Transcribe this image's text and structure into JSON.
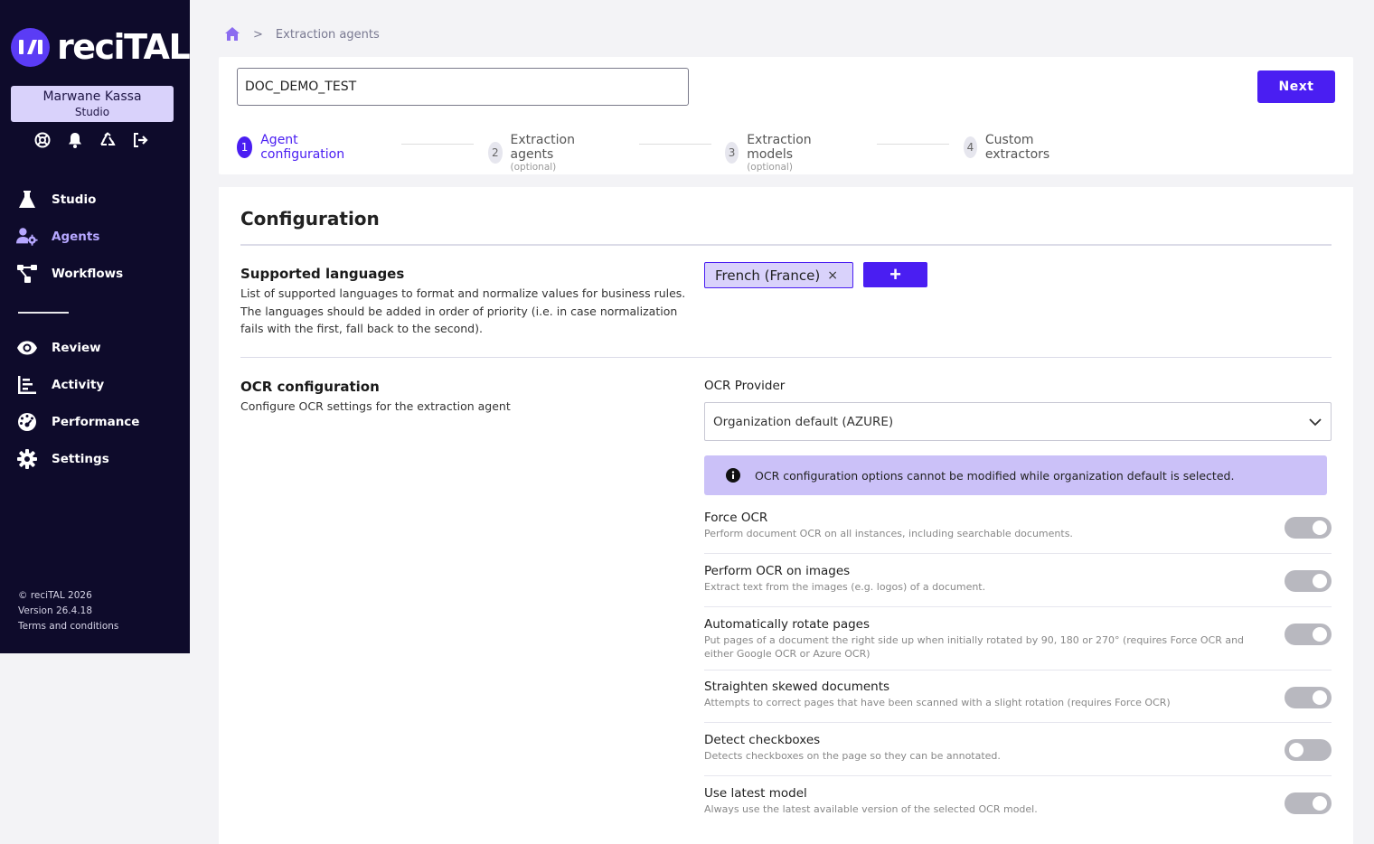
{
  "brand": {
    "logo_mark": "I/I",
    "name": "reciTAL"
  },
  "user": {
    "name": "Marwane Kassa",
    "role": "Studio"
  },
  "quick_icons": [
    "support-icon",
    "bell-icon",
    "recycle-icon",
    "logout-icon"
  ],
  "nav": {
    "primary": [
      {
        "label": "Studio",
        "icon": "flask-icon"
      },
      {
        "label": "Agents",
        "icon": "agents-icon",
        "active": true
      },
      {
        "label": "Workflows",
        "icon": "workflow-icon"
      }
    ],
    "secondary": [
      {
        "label": "Review",
        "icon": "eye-icon"
      },
      {
        "label": "Activity",
        "icon": "chart-icon"
      },
      {
        "label": "Performance",
        "icon": "gauge-icon"
      },
      {
        "label": "Settings",
        "icon": "gear-icon"
      }
    ]
  },
  "footer": {
    "copyright": "© reciTAL 2026",
    "version": "Version 26.4.18",
    "terms": "Terms and conditions"
  },
  "breadcrumb": {
    "separator": ">",
    "current": "Extraction agents"
  },
  "agent_name": {
    "value": "DOC_DEMO_TEST"
  },
  "next_label": "Next",
  "steps": [
    {
      "num": "1",
      "label": "Agent configuration",
      "sub": "",
      "active": true
    },
    {
      "num": "2",
      "label": "Extraction agents",
      "sub": "(optional)"
    },
    {
      "num": "3",
      "label": "Extraction models",
      "sub": "(optional)"
    },
    {
      "num": "4",
      "label": "Custom extractors",
      "sub": ""
    }
  ],
  "config": {
    "title": "Configuration",
    "languages": {
      "title": "Supported languages",
      "desc_lines": [
        "List of supported languages to format and normalize values for business rules.",
        "The languages should be added in order of priority (i.e. in case normalization",
        "fails with the first, fall back to the second)."
      ],
      "chips": [
        "French (France)"
      ],
      "chip_remove": "×",
      "add_label": "+"
    },
    "ocr": {
      "title": "OCR configuration",
      "desc": "Configure OCR settings for the extraction agent",
      "provider_label": "OCR Provider",
      "provider_value": "Organization default (AZURE)",
      "info": "OCR configuration options cannot be modified while organization default is selected.",
      "options": [
        {
          "title": "Force OCR",
          "desc": "Perform document OCR on all instances, including searchable documents.",
          "enabled": true
        },
        {
          "title": "Perform OCR on images",
          "desc": "Extract text from the images (e.g. logos) of a document.",
          "enabled": true
        },
        {
          "title": "Automatically rotate pages",
          "desc": "Put pages of a document the right side up when initially rotated by 90, 180 or 270° (requires Force OCR and either Google OCR or Azure OCR)",
          "enabled": true
        },
        {
          "title": "Straighten skewed documents",
          "desc": "Attempts to correct pages that have been scanned with a slight rotation (requires Force OCR)",
          "enabled": true
        },
        {
          "title": "Detect checkboxes",
          "desc": "Detects checkboxes on the page so they can be annotated.",
          "enabled": false
        },
        {
          "title": "Use latest model",
          "desc": "Always use the latest available version of the selected OCR model.",
          "enabled": true
        }
      ]
    }
  },
  "colors": {
    "sidebar": "#0e0b2b",
    "accent": "#4a1ef2",
    "chip_bg": "#d9d2fb",
    "info_bg": "#cbc1f8",
    "active_nav": "#b6a7ff"
  }
}
